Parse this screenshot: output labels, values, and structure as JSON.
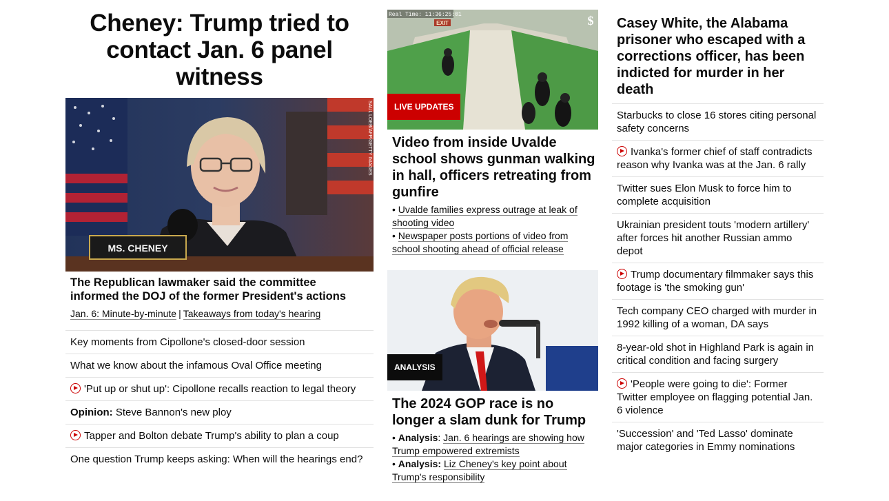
{
  "left": {
    "headline": "Cheney: Trump tried to contact Jan. 6 panel witness",
    "photo_credit": "SAUL LOEB/AFP/GETTY IMAGES",
    "nameplate": "MS. CHENEY",
    "subheadline": "The Republican lawmaker said the committee informed the DOJ of the former President's actions",
    "links": [
      "Jan. 6: Minute-by-minute",
      "Takeaways from today's hearing"
    ],
    "separator": "|",
    "list": [
      {
        "text": "Key moments from Cipollone's closed-door session",
        "video": false
      },
      {
        "text": "What we know about the infamous Oval Office meeting",
        "video": false
      },
      {
        "text": "'Put up or shut up': Cipollone recalls reaction to legal theory",
        "video": true
      },
      {
        "prefix": "Opinion:",
        "text": "Steve Bannon's new ploy",
        "video": false
      },
      {
        "text": "Tapper and Bolton debate Trump's ability to plan a coup",
        "video": true
      },
      {
        "text": "One question Trump keeps asking: When will the hearings end?",
        "video": false
      }
    ]
  },
  "mid": {
    "story1": {
      "timestamp": "Real Time: 11:36:25:01",
      "badge": "LIVE UPDATES",
      "headline": "Video from inside Uvalde school shows gunman walking in hall, officers retreating from gunfire",
      "bullets": [
        "Uvalde families express outrage at leak of shooting video",
        "Newspaper posts portions of video from school shooting ahead of official release"
      ]
    },
    "story2": {
      "badge": "ANALYSIS",
      "headline": "The 2024 GOP race is no longer a slam dunk for Trump",
      "bullets": [
        {
          "prefix": "Analysis",
          "text": "Jan. 6 hearings are showing how Trump empowered extremists"
        },
        {
          "prefix": "Analysis:",
          "text": "Liz Cheney's key point about Trump's responsibility"
        }
      ]
    }
  },
  "right": {
    "headline": "Casey White, the Alabama prisoner who escaped with a corrections officer, has been indicted for murder in her death",
    "list": [
      {
        "text": "Starbucks to close 16 stores citing personal safety concerns",
        "video": false
      },
      {
        "text": "Ivanka's former chief of staff contradicts reason why Ivanka was at the Jan. 6 rally",
        "video": true
      },
      {
        "text": "Twitter sues Elon Musk to force him to complete acquisition",
        "video": false
      },
      {
        "text": "Ukrainian president touts 'modern artillery' after forces hit another Russian ammo depot",
        "video": false
      },
      {
        "text": "Trump documentary filmmaker says this footage is 'the smoking gun'",
        "video": true
      },
      {
        "text": "Tech company CEO charged with murder in 1992 killing of a woman, DA says",
        "video": false
      },
      {
        "text": "8-year-old shot in Highland Park is again in critical condition and facing surgery",
        "video": false
      },
      {
        "text": "'People were going to die': Former Twitter employee on flagging potential Jan. 6 violence",
        "video": true
      },
      {
        "text": "'Succession' and 'Ted Lasso' dominate major categories in Emmy nominations",
        "video": false
      }
    ]
  },
  "colors": {
    "accent_red": "#cc0000",
    "text": "#0c0c0c",
    "divider": "#e2e2e2",
    "badge_dark": "#0c0c0c"
  }
}
